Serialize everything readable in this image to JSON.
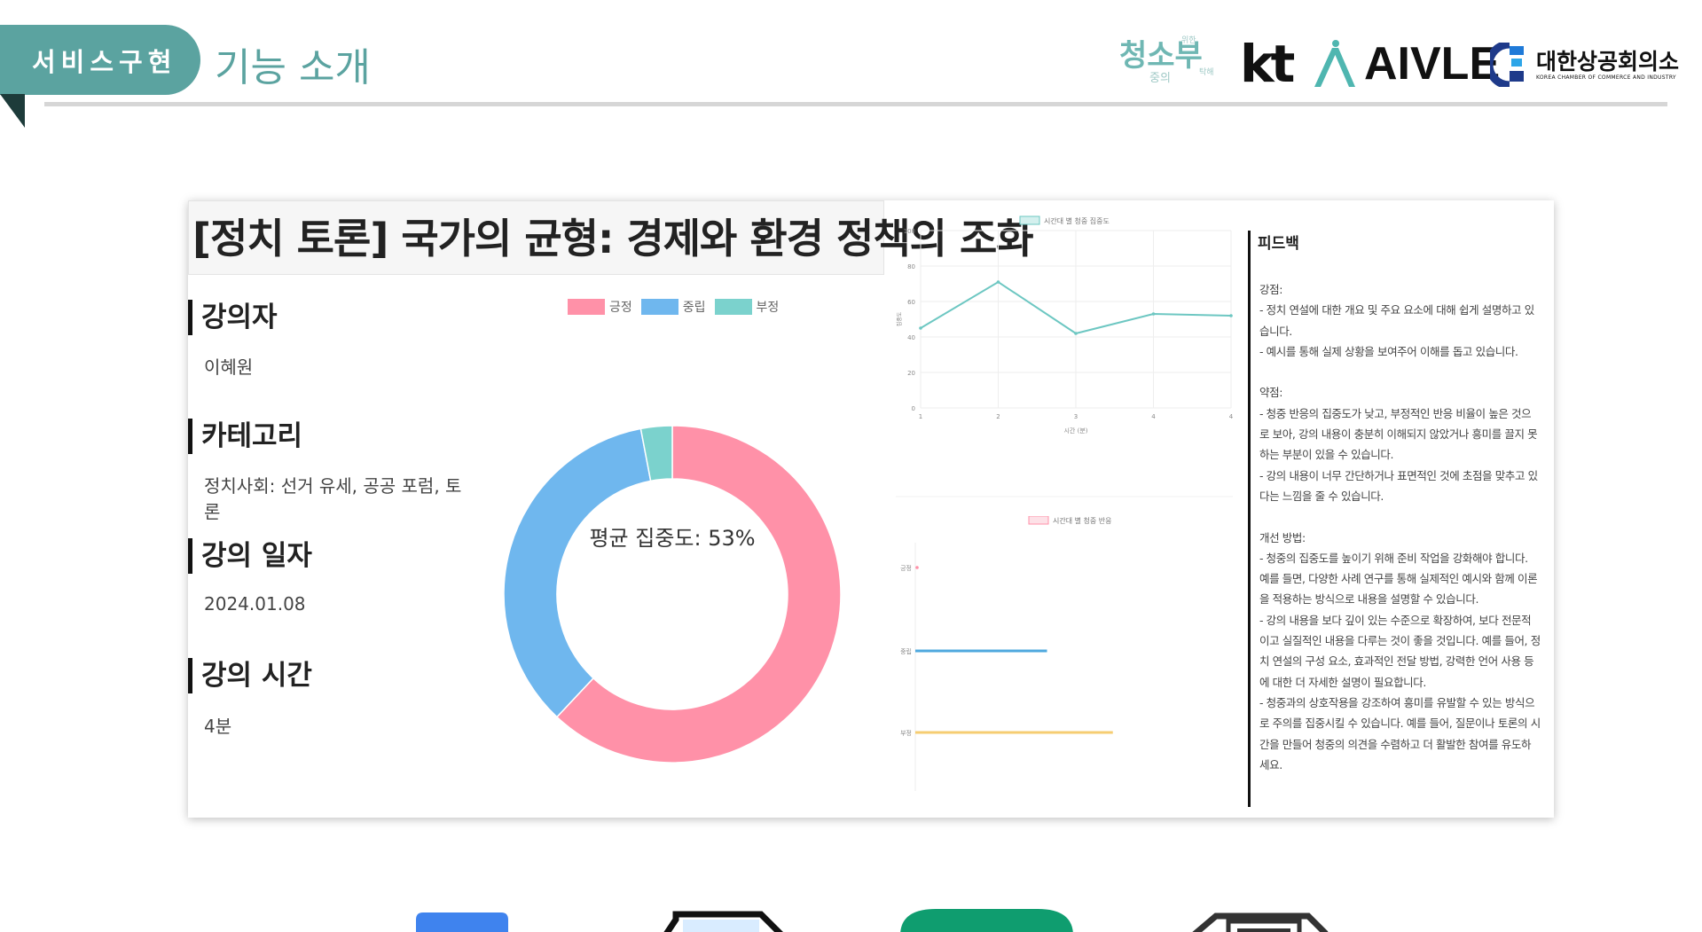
{
  "header": {
    "tab_label": "서비스구현",
    "section_title": "기능 소개",
    "logos": {
      "cheong_main": "청소부",
      "cheong_small_1": "중의",
      "cheong_small_2": "위한",
      "cheong_small_3": "탁해",
      "kt": "kt",
      "aivle": "AIVLE",
      "kcci_kr": "대한상공회의소",
      "kcci_en": "KOREA CHAMBER OF COMMERCE AND INDUSTRY"
    }
  },
  "lecture": {
    "title": "[정치 토론] 국가의 균형: 경제와 환경 정책의 조화",
    "fields": [
      {
        "label": "강의자",
        "value": "이혜원"
      },
      {
        "label": "카테고리",
        "value": "정치사회: 선거 유세, 공공 포럼, 토론"
      },
      {
        "label": "강의 일자",
        "value": "2024.01.08"
      },
      {
        "label": "강의 시간",
        "value": "4분"
      }
    ]
  },
  "colors": {
    "teal": "#5ba3a0",
    "positive": "#ff91a8",
    "neutral": "#6fb7ee",
    "negative": "#7bd2cd",
    "line": "#6dc7c2",
    "neutral_bar": "#4ea8de",
    "negative_bar": "#f6cd72"
  },
  "chart_data": [
    {
      "type": "pie",
      "labels": [
        "긍정",
        "중립",
        "부정"
      ],
      "values": [
        62,
        35,
        3
      ],
      "center_label": "평균 집중도: 53%"
    },
    {
      "type": "line",
      "legend": "시간대 별 청중 집중도",
      "xlabel": "시간 (분)",
      "ylabel": "집중도",
      "x": [
        1,
        2,
        3,
        4,
        5
      ],
      "x_tick_labels": [
        "1",
        "2",
        "3",
        "4",
        "4"
      ],
      "y": [
        45,
        71,
        42,
        53,
        52
      ],
      "ylim": [
        0,
        100
      ],
      "yticks": [
        0,
        20,
        40,
        60,
        80,
        100
      ]
    },
    {
      "type": "bar",
      "legend": "시간대 별 청중 반응",
      "categories": [
        "긍정",
        "중립",
        "부정"
      ],
      "values": [
        0,
        1.8,
        2.7
      ],
      "xlim": [
        0,
        4
      ]
    }
  ],
  "feedback": {
    "title": "피드백",
    "body": "강점:\n- 정치 연설에 대한 개요 및 주요 요소에 대해 쉽게 설명하고 있습니다.\n- 예시를 통해 실제 상황을 보여주어 이해를 돕고 있습니다.\n\n약점:\n- 청중 반응의 집중도가 낮고, 부정적인 반응 비율이 높은 것으로 보아, 강의 내용이 충분히 이해되지 않았거나 흥미를 끌지 못하는 부분이 있을 수 있습니다.\n- 강의 내용이 너무 간단하거나 표면적인 것에 초점을 맞추고 있다는 느낌을 줄 수 있습니다.\n\n개선 방법:\n- 청중의 집중도를 높이기 위해 준비 작업을 강화해야 합니다. 예를 들면, 다양한 사례 연구를 통해 실제적인 예시와 함께 이론을 적용하는 방식으로 내용을 설명할 수 있습니다.\n- 강의 내용을 보다 깊이 있는 수준으로 확장하여, 보다 전문적이고 실질적인 내용을 다루는 것이 좋을 것입니다. 예를 들어, 정치 연설의 구성 요소, 효과적인 전달 방법, 강력한 언어 사용 등에 대한 더 자세한 설명이 필요합니다.\n- 청중과의 상호작용을 강조하여 흥미를 유발할 수 있는 방식으로 주의를 집중시킬 수 있습니다. 예를 들어, 질문이나 토론의 시간을 만들어 청중의 의견을 수렴하고 더 활발한 참여를 유도하세요."
  },
  "bottom_icons": [
    "google-docs-icon",
    "file-icon",
    "sheets-icon",
    "printer-icon"
  ]
}
